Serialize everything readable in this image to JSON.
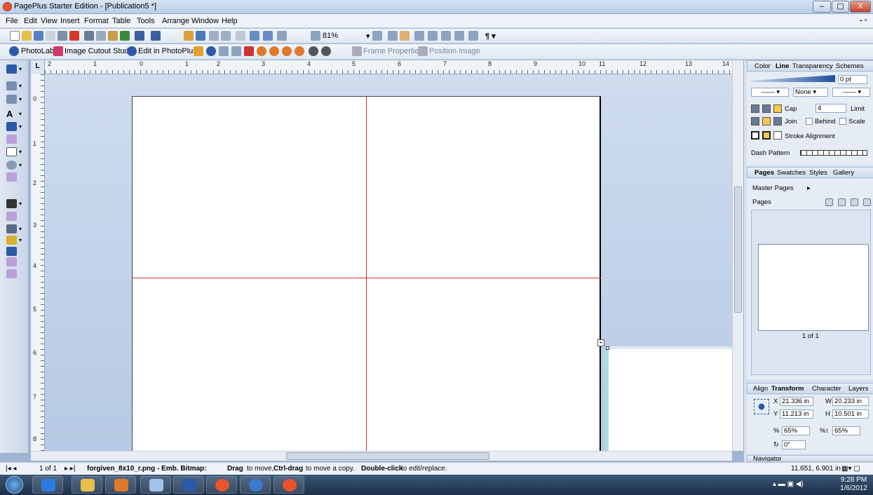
{
  "window": {
    "title": "PagePlus Starter Edition - [Publication5 *]",
    "min": "–",
    "max": "▢",
    "close": "X"
  },
  "menu": [
    "File",
    "Edit",
    "View",
    "Insert",
    "Format",
    "Table",
    "Tools",
    "Arrange",
    "Window",
    "Help"
  ],
  "toolbar1": {
    "zoom": "81%"
  },
  "toolbar2": {
    "photolab": "PhotoLab",
    "cutout": "Image Cutout Studio",
    "photoplus": "Edit in PhotoPlus",
    "frame_props": "Frame Properties",
    "position_image": "Position Image"
  },
  "ruler": {
    "h": [
      "2",
      "1",
      "0",
      "1",
      "2",
      "3",
      "4",
      "5",
      "6",
      "7",
      "8",
      "9",
      "10",
      "11",
      "12",
      "13",
      "14"
    ],
    "v": [
      "0",
      "1",
      "2",
      "3",
      "4",
      "5",
      "6",
      "7",
      "8"
    ]
  },
  "line_panel": {
    "tabs": [
      "Color",
      "Line",
      "Transparency",
      "Schemes"
    ],
    "weight": "0 pt",
    "none_label": "None",
    "cap_label": "Cap",
    "cap_value": "4",
    "limit_label": "Limit",
    "join_label": "Join",
    "behind_label": "Behind",
    "scale_label": "Scale",
    "stroke_alignment": "Stroke Alignment",
    "dash_pattern": "Dash Pattern"
  },
  "pages_panel": {
    "tabs": [
      "Pages",
      "Swatches",
      "Styles",
      "Gallery"
    ],
    "master_pages": "Master Pages",
    "pages": "Pages",
    "page_count": "1 of 1"
  },
  "transform_panel": {
    "tabs": [
      "Align",
      "Transform",
      "Character",
      "Layers"
    ],
    "x_label": "X",
    "x": "21.336 in",
    "w_label": "W",
    "w": "20.233 in",
    "y_label": "Y",
    "y": "11.213 in",
    "h_label": "H",
    "h": "10.501 in",
    "scale_x": "65%",
    "scale_y": "65%",
    "rotate": "0°"
  },
  "navigator": {
    "label": "Navigator"
  },
  "status": {
    "page": "1 of 1",
    "filename": "forgiven_8x10_r.png - Emb. Bitmap:",
    "hint1": "Drag",
    "hint2": "to move,",
    "hint3": "Ctrl-drag",
    "hint4": "to move a copy.",
    "hint5": "Double-click",
    "hint6": "to edit/replace.",
    "coords": "11.651, 6.901 in"
  },
  "clock": {
    "time": "9:28 PM",
    "date": "1/6/2012"
  }
}
